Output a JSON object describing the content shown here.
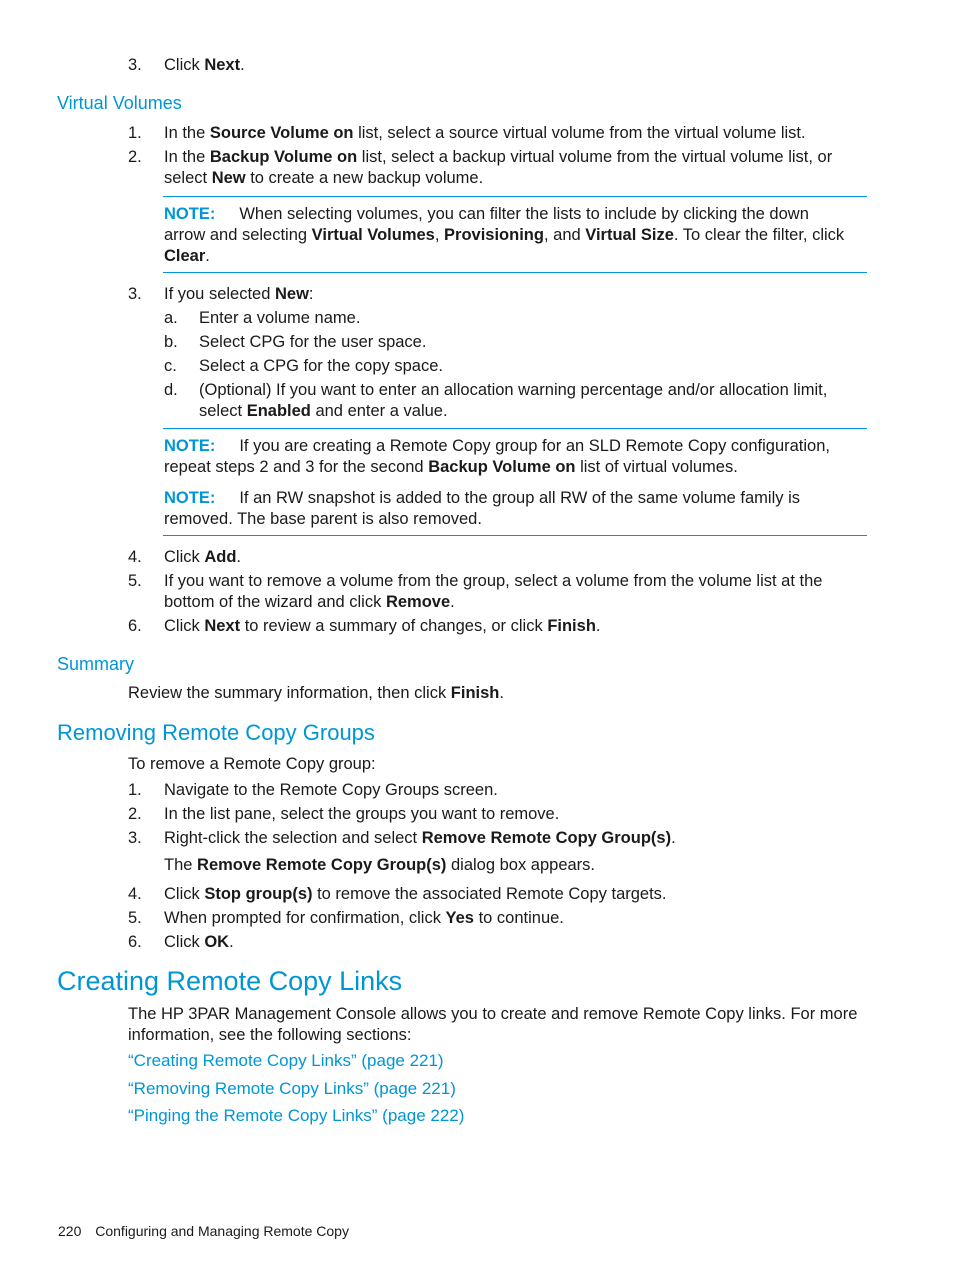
{
  "top_step": {
    "num": "3.",
    "pre": "Click ",
    "bold": "Next",
    "post": "."
  },
  "virtual_volumes": {
    "heading": "Virtual Volumes",
    "steps": [
      {
        "num": "1.",
        "line1_pre": "In the ",
        "line1_bold": "Source Volume on",
        "line1_post": " list, select a source virtual volume from the virtual volume list."
      },
      {
        "num": "2.",
        "line1_pre": "In the ",
        "line1_bold": "Backup Volume on",
        "line1_post": " list, select a backup virtual volume from the virtual volume list, or",
        "line2_pre": "select ",
        "line2_bold": "New",
        "line2_post": " to create a new backup volume."
      }
    ],
    "note1": {
      "label": "NOTE:",
      "line1": "When selecting volumes, you can filter the lists to include by clicking the down",
      "line2_pre": "arrow and selecting ",
      "b1": "Virtual Volumes",
      "sep1": ", ",
      "b2": "Provisioning",
      "sep2": ", and ",
      "b3": "Virtual Size",
      "line2_post": ". To clear the filter, click",
      "line3_bold": "Clear",
      "line3_post": "."
    },
    "step3": {
      "num": "3.",
      "pre": "If you selected ",
      "bold": "New",
      "post": ":",
      "substeps": [
        {
          "letter": "a.",
          "text": "Enter a volume name."
        },
        {
          "letter": "b.",
          "text": "Select CPG for the user space."
        },
        {
          "letter": "c.",
          "text": "Select a CPG for the copy space."
        },
        {
          "letter": "d.",
          "line1": "(Optional) If you want to enter an allocation warning percentage and/or allocation limit,",
          "line2_pre": "select ",
          "line2_bold": "Enabled",
          "line2_post": " and enter a value."
        }
      ]
    },
    "note2": {
      "label": "NOTE:",
      "line1": "If you are creating a Remote Copy group for an SLD Remote Copy configuration,",
      "line2_pre": "repeat steps 2 and 3 for the second ",
      "line2_bold": "Backup Volume on",
      "line2_post": " list of virtual volumes."
    },
    "note3": {
      "label": "NOTE:",
      "line1": "If an RW snapshot is added to the group all RW of the same volume family is",
      "line2": "removed. The base parent is also removed."
    },
    "step4": {
      "num": "4.",
      "pre": "Click ",
      "bold": "Add",
      "post": "."
    },
    "step5": {
      "num": "5.",
      "line1": "If you want to remove a volume from the group, select a volume from the volume list at the",
      "line2_pre": "bottom of the wizard and click ",
      "line2_bold": "Remove",
      "line2_post": "."
    },
    "step6": {
      "num": "6.",
      "pre": "Click ",
      "b1": "Next",
      "mid": " to review a summary of changes, or click ",
      "b2": "Finish",
      "post": "."
    }
  },
  "summary": {
    "heading": "Summary",
    "pre": "Review the summary information, then click ",
    "bold": "Finish",
    "post": "."
  },
  "removing_groups": {
    "heading": "Removing Remote Copy Groups",
    "intro": "To remove a Remote Copy group:",
    "steps": [
      {
        "num": "1.",
        "text": "Navigate to the Remote Copy Groups screen."
      },
      {
        "num": "2.",
        "text": "In the list pane, select the groups you want to remove."
      },
      {
        "num": "3.",
        "pre": "Right-click the selection and select ",
        "bold": "Remove Remote Copy Group(s)",
        "post": "."
      },
      {
        "result_pre": "The ",
        "result_bold": "Remove Remote Copy Group(s)",
        "result_post": " dialog box appears."
      },
      {
        "num": "4.",
        "pre": "Click ",
        "bold": "Stop group(s)",
        "post": " to remove the associated Remote Copy targets."
      },
      {
        "num": "5.",
        "pre": "When prompted for confirmation, click ",
        "bold": "Yes",
        "post": " to continue."
      },
      {
        "num": "6.",
        "pre": "Click ",
        "bold": "OK",
        "post": "."
      }
    ]
  },
  "creating_links": {
    "heading": "Creating Remote Copy Links",
    "line1": "The HP 3PAR Management Console allows you to create and remove Remote Copy links. For more",
    "line2": "information, see the following sections:",
    "links": [
      "“Creating Remote Copy Links” (page 221)",
      "“Removing Remote Copy Links” (page 221)",
      "“Pinging the Remote Copy Links” (page 222)"
    ]
  },
  "footer": {
    "page_number": "220",
    "chapter": "Configuring and Managing Remote Copy"
  },
  "colors": {
    "accent": "#0096d6",
    "text": "#1a1a1a"
  }
}
